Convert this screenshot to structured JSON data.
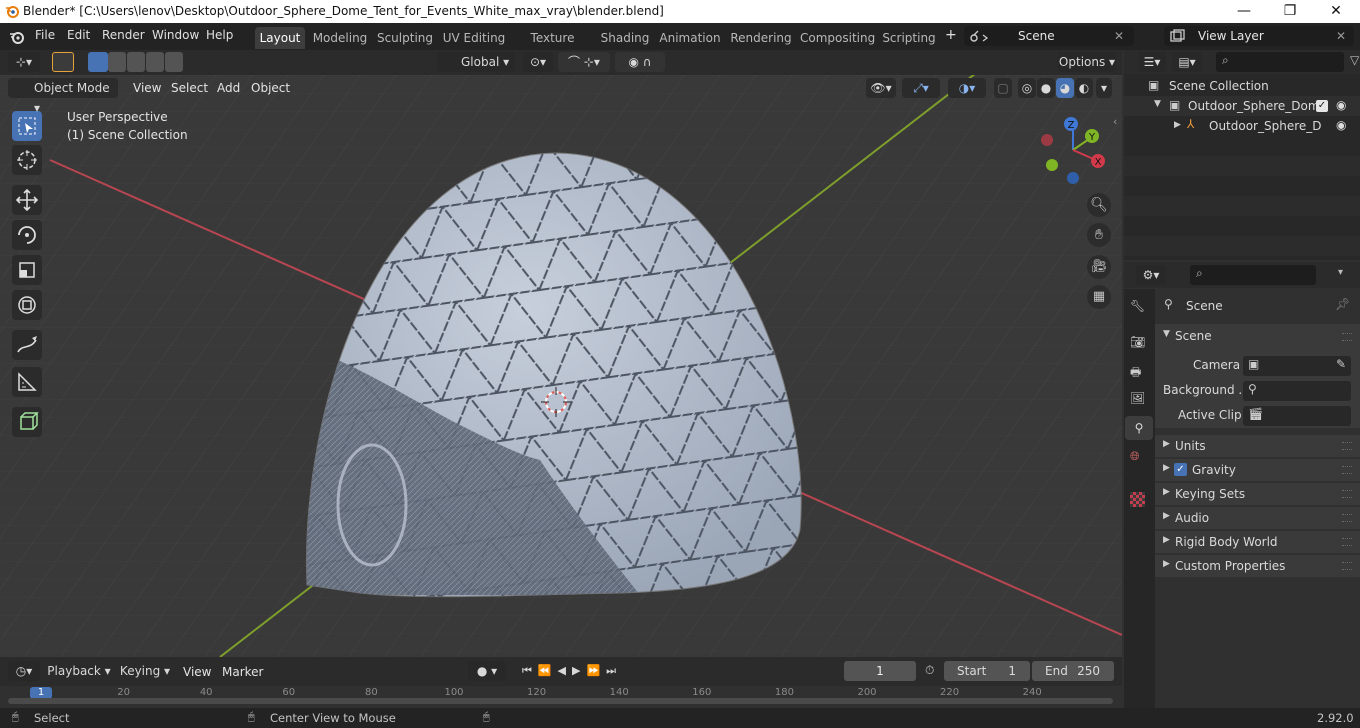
{
  "window": {
    "title": "Blender* [C:\\Users\\lenov\\Desktop\\Outdoor_Sphere_Dome_Tent_for_Events_White_max_vray\\blender.blend]",
    "minimize": "—",
    "maximize": "❐",
    "close": "✕"
  },
  "menu": [
    "File",
    "Edit",
    "Render",
    "Window",
    "Help"
  ],
  "workspaces": [
    "Layout",
    "Modeling",
    "Sculpting",
    "UV Editing",
    "Texture Paint",
    "Shading",
    "Animation",
    "Rendering",
    "Compositing",
    "Scripting"
  ],
  "workspace_add": "+",
  "scene_field": "Scene",
  "view_layer_field": "View Layer",
  "toolbar": {
    "orientation": "Global",
    "options": "Options"
  },
  "viewport_header": {
    "mode": "Object Mode",
    "menus": [
      "View",
      "Select",
      "Add",
      "Object"
    ]
  },
  "viewport": {
    "info_line1": "User Perspective",
    "info_line2": "(1) Scene Collection",
    "gizmo": {
      "x": "X",
      "y": "Y",
      "z": "Z"
    },
    "colors": {
      "x_axis": "#c9424d",
      "y_axis": "#82b324",
      "dome": "#b7c0cf",
      "x_ball": "#d13a4a",
      "y_ball": "#7fb524",
      "z_ball": "#3f78d6"
    }
  },
  "outliner": {
    "root": "Scene Collection",
    "items": [
      "Outdoor_Sphere_Dome_T",
      "Outdoor_Sphere_Dor"
    ]
  },
  "properties": {
    "header": "Scene",
    "panel": "Scene",
    "fields": [
      {
        "label": "Camera",
        "value": ""
      },
      {
        "label": "Background ...",
        "value": ""
      },
      {
        "label": "Active Clip",
        "value": ""
      }
    ],
    "sections": [
      "Units",
      "Gravity",
      "Keying Sets",
      "Audio",
      "Rigid Body World",
      "Custom Properties"
    ],
    "gravity_checked": true
  },
  "timeline": {
    "menus": [
      "Playback",
      "Keying",
      "View",
      "Marker"
    ],
    "current_frame": "1",
    "start_label": "Start",
    "start": "1",
    "end_label": "End",
    "end": "250",
    "ticks": [
      "20",
      "40",
      "60",
      "80",
      "100",
      "120",
      "140",
      "160",
      "180",
      "200",
      "220",
      "240"
    ],
    "cursor_frame": "1"
  },
  "status": {
    "left": "Select",
    "middle": "Center View to Mouse",
    "version": "2.92.0"
  }
}
